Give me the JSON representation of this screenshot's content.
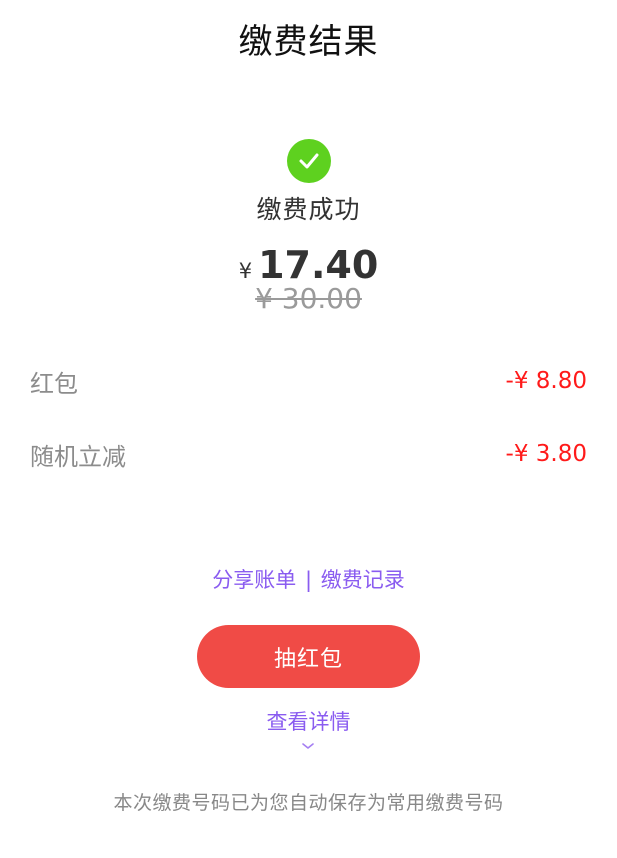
{
  "header": {
    "title": "缴费结果"
  },
  "status": {
    "icon": "check-circle-icon",
    "text": "缴费成功",
    "color": "#5ed11f"
  },
  "amount": {
    "currency": "¥",
    "paid": "17.40",
    "original": "¥ 30.00"
  },
  "discounts": [
    {
      "label": "红包",
      "value": "-¥ 8.80"
    },
    {
      "label": "随机立减",
      "value": "-¥ 3.80"
    }
  ],
  "links": {
    "share": "分享账单",
    "separator": "|",
    "records": "缴费记录",
    "color": "#8a5cf0"
  },
  "actions": {
    "redpacket_label": "抽红包",
    "button_color": "#f04b46",
    "details_label": "查看详情",
    "details_icon": "chevron-down-icon"
  },
  "footer": {
    "note": "本次缴费号码已为您自动保存为常用缴费号码"
  }
}
